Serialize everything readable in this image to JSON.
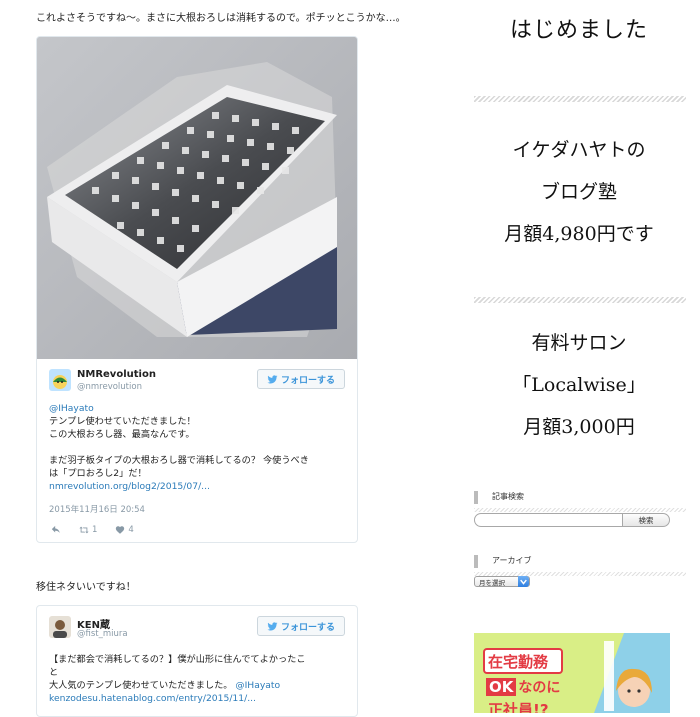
{
  "main": {
    "intro_text": "これよさそうですね〜。まさに大根おろしは消耗するので。ポチッとこうかな…。",
    "between_text": "移住ネタいいですね！",
    "tweets": [
      {
        "name": "NMRevolution",
        "handle": "@nmrevolution",
        "follow_label": "フォローする",
        "lines": [
          "@IHayato",
          "テンプレ使わせていただきました！",
          "この大根おろし器、最高なんです。",
          "",
          "まだ羽子板タイプの大根おろし器で消耗してるの？ 今使うべき",
          "は「プロおろし2」だ！",
          "nmrevolution.org/blog2/2015/07/..."
        ],
        "date": "2015年11月16日 20:54",
        "retweet_count": "1",
        "like_count": "4"
      },
      {
        "name": "KEN蔵",
        "handle": "@fist_miura",
        "follow_label": "フォローする",
        "lines": [
          "【まだ都会で消耗してるの？】僕が山形に住んでてよかったこ",
          "と",
          "大人気のテンプレ使わせていただきました。",
          "@IHayato",
          "kenzodesu.hatenablog.com/entry/2015/11/..."
        ]
      }
    ]
  },
  "sidebar": {
    "title": "はじめました",
    "promo1": [
      "イケダハヤトの",
      "ブログ塾",
      "月額4,980円です"
    ],
    "promo2": [
      "有料サロン",
      "「Localwise」",
      "月額3,000円"
    ],
    "search_widget": {
      "title": "記事検索",
      "input_value": "",
      "button_label": "検索"
    },
    "archive_widget": {
      "title": "アーカイブ",
      "select_label": "月を選択"
    },
    "banner": {
      "line1": "在宅勤務",
      "line2_a": "OK",
      "line2_b": "なのに",
      "line3": "正社員!?"
    }
  },
  "colors": {
    "twitter_blue": "#3b94d9",
    "link_blue": "#2b7bb9",
    "banner_bg": "#d9ee86",
    "banner_red": "#e33b44"
  }
}
